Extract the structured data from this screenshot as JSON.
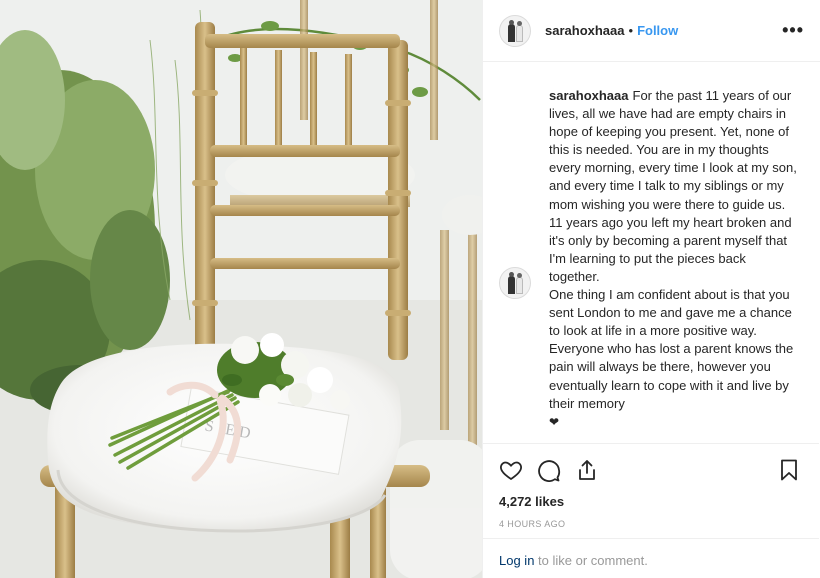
{
  "post": {
    "username": "sarahoxhaaa",
    "separator": "•",
    "follow_label": "Follow",
    "more_icon": "more-options-icon",
    "caption": {
      "username": "sarahoxhaaa",
      "paragraph1": "For the past 11 years of our lives, all we have had are empty chairs in hope of keeping you present. Yet, none of this is needed. You are in my thoughts every morning, every time I look at my son, and every time I talk to my siblings or my mom wishing you were there to guide us. 11 years ago you left my heart broken and it's only by becoming a parent myself that I'm learning to put the pieces back together.",
      "paragraph2": "One thing I am confident about is that you sent London to me and gave me a chance to look at life in a more positive way. Everyone who has lost a parent knows the pain will always be there, however you eventually learn to cope with it and live by their memory",
      "trailing_emoji": "❤"
    },
    "likes": "4,272 likes",
    "timestamp": "4 HOURS AGO",
    "login_link": "Log in",
    "login_rest": " to like or comment.",
    "card_text": "S   ED",
    "icons": [
      "heart-icon",
      "comment-icon",
      "share-icon",
      "bookmark-icon"
    ]
  }
}
